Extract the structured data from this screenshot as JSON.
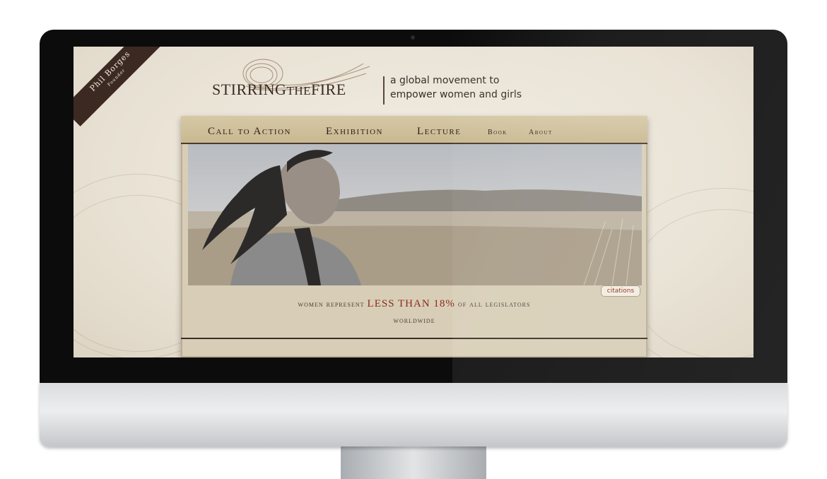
{
  "ribbon": {
    "name": "Phil Borges",
    "role": "Founder"
  },
  "logo": {
    "word1": "Stirring",
    "word2": "the",
    "word3": "Fire"
  },
  "tagline": {
    "line1": "a global movement to",
    "line2": "empower women and girls"
  },
  "nav": {
    "items": [
      "Call to Action",
      "Exhibition",
      "Lecture",
      "Book",
      "About"
    ]
  },
  "hero": {
    "alt_icon": "portrait-photo"
  },
  "caption": {
    "pre": "women represent",
    "highlight": "LESS THAN 18%",
    "post": "of all legislators",
    "line2": "worldwide"
  },
  "citations_label": "citations",
  "colors": {
    "accent": "#8b2a1e",
    "brand_dark": "#3a2b22",
    "background": "#ece5d8"
  }
}
